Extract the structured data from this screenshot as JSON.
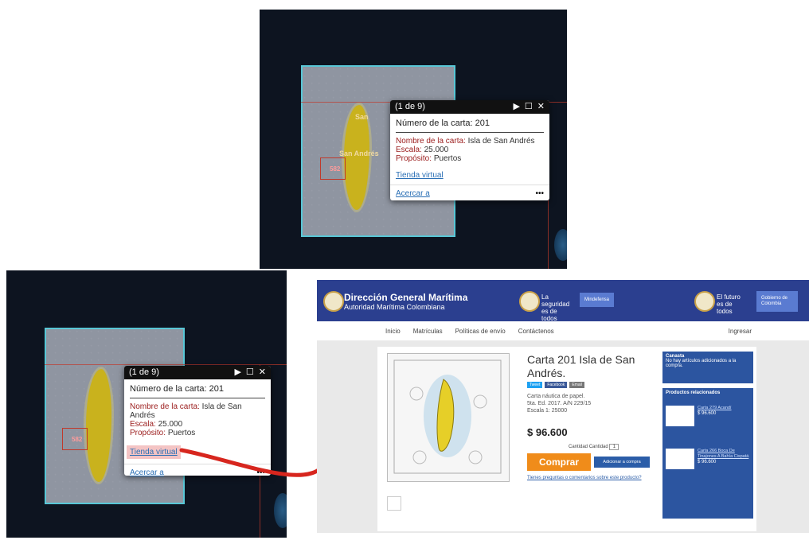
{
  "popup": {
    "counter": "(1 de 9)",
    "play_icon": "▶",
    "maximize_icon": "☐",
    "close_icon": "✕",
    "title": "Número de la carta: 201",
    "name_key": "Nombre de la carta:",
    "name_val": "Isla de San Andrés",
    "scale_key": "Escala:",
    "scale_val": "25.000",
    "purpose_key": "Propósito:",
    "purpose_val": "Puertos",
    "shop_link": "Tienda virtual",
    "zoom_link": "Acercar a",
    "more": "•••"
  },
  "map": {
    "label_san": "San",
    "label_andres": "San Andrés",
    "zone_tag": "582"
  },
  "shop": {
    "brand_title": "Dirección General Marítima",
    "brand_sub": "Autoridad Marítima Colombiana",
    "slogan1": "La seguridad es de todos",
    "pill1": "Mindefensa",
    "slogan2": "El futuro es de todos",
    "pill2": "Gobierno de Colombia",
    "nav": [
      "Inicio",
      "Matrículas",
      "Políticas de envío",
      "Contáctenos"
    ],
    "login": "Ingresar",
    "product_title": "Carta 201 Isla de San Andrés.",
    "social": [
      "Tweet",
      "Facebook",
      "Email"
    ],
    "desc": [
      "Carta náutica de papel.",
      "5ta. Ed. 2017. A/N 229/15",
      "Escala 1: 25000"
    ],
    "price": "$ 96.600",
    "qty_label": "Cantidad",
    "qty_value": "1",
    "buy": "Comprar",
    "add": "Adicionar a compra",
    "ask": "Tienes preguntas o comentarios sobre este producto?",
    "cart_title": "Canasta",
    "cart_text": "No hay artículos adicionados a la compra.",
    "related_title": "Productos relacionados",
    "related": [
      {
        "title": "Carta 279 Acandí",
        "price": "$ 96.600"
      },
      {
        "title": "Carta 266 Boca De Tinajones A Bahía Cispatá",
        "price": "$ 96.600"
      }
    ]
  },
  "colors": {
    "highlight": "#f4c4c4",
    "arrow": "#d7261e",
    "border_cyan": "#58c7d6"
  }
}
